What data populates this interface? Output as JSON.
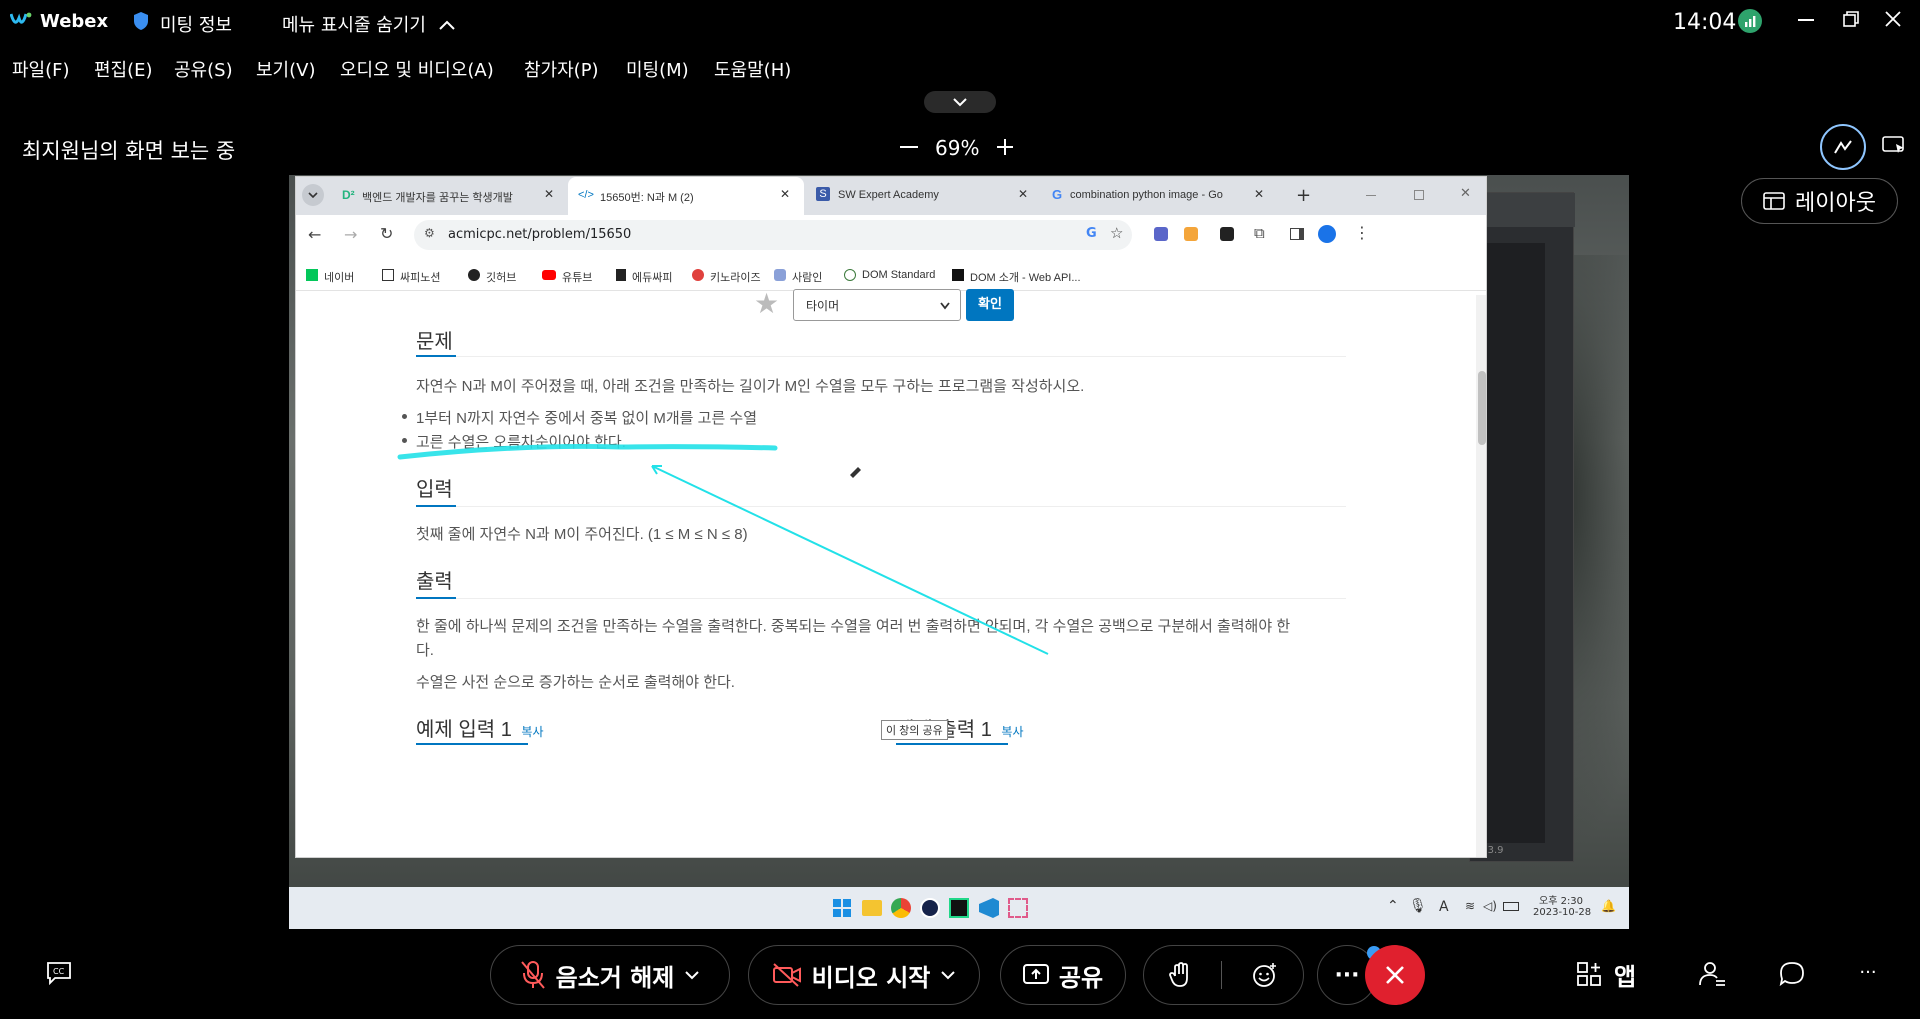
{
  "titlebar": {
    "app_name": "Webex",
    "meeting_info": "미팅 정보",
    "menu_toggle": "메뉴 표시줄 숨기기",
    "clock": "14:04"
  },
  "menubar": {
    "items": [
      "파일(F)",
      "편집(E)",
      "공유(S)",
      "보기(V)",
      "오디오 및 비디오(A)",
      "참가자(P)",
      "미팅(M)",
      "도움말(H)"
    ]
  },
  "sharebar": {
    "viewing": "최지원님의 화면 보는 중",
    "zoom": "69%",
    "layout_button": "레이아웃"
  },
  "browser": {
    "tabs": [
      {
        "label": "백엔드 개발자를 꿈꾸는 학생개발",
        "icon": "D²",
        "active": false
      },
      {
        "label": "15650번: N과 M (2)",
        "icon": "</>",
        "active": true
      },
      {
        "label": "SW Expert Academy",
        "icon": "S",
        "active": false
      },
      {
        "label": "combination python image - Go",
        "icon": "G",
        "active": false
      }
    ],
    "url": "acmicpc.net/problem/15650",
    "bookmarks": [
      "네이버",
      "싸피노션",
      "깃허브",
      "유튜브",
      "에듀싸피",
      "키노라이즈",
      "사람인",
      "DOM Standard",
      "DOM 소개 - Web API..."
    ]
  },
  "page": {
    "select_value": "타이머",
    "confirm_button": "확인",
    "sections": {
      "problem_title": "문제",
      "problem_text": "자연수 N과 M이 주어졌을 때, 아래 조건을 만족하는 길이가 M인 수열을 모두 구하는 프로그램을 작성하시오.",
      "bullets": [
        "1부터 N까지 자연수 중에서 중복 없이 M개를 고른 수열",
        "고른 수열은 오름차순이어야 한다."
      ],
      "input_title": "입력",
      "input_text": "첫째 줄에 자연수 N과 M이 주어진다. (1 ≤ M ≤ N ≤ 8)",
      "output_title": "출력",
      "output_text_1": "한 줄에 하나씩 문제의 조건을 만족하는 수열을 출력한다. 중복되는 수열을 여러 번 출력하면 안되며, 각 수열은 공백으로 구분해서 출력해야 한",
      "output_text_2": "다.",
      "output_text_3": "수열은 사전 순으로 증가하는 순서로 출력해야 한다.",
      "example_input_title": "예제 입력 1",
      "example_output_title": "예제 출력 1",
      "copy": "복사"
    },
    "tooltip": "이 창의 공유"
  },
  "remote_taskbar": {
    "time_ampm": "오후 2:30",
    "date": "2023-10-28",
    "ime": "A",
    "side_label": "on 3.9"
  },
  "bottombar": {
    "unmute": "음소거 해제",
    "start_video": "비디오 시작",
    "share": "공유",
    "apps": "앱"
  },
  "colors": {
    "accent": "#0076c0",
    "annotation": "#22e1e8",
    "end_call": "#e0202e",
    "signal": "#2ea36c"
  }
}
